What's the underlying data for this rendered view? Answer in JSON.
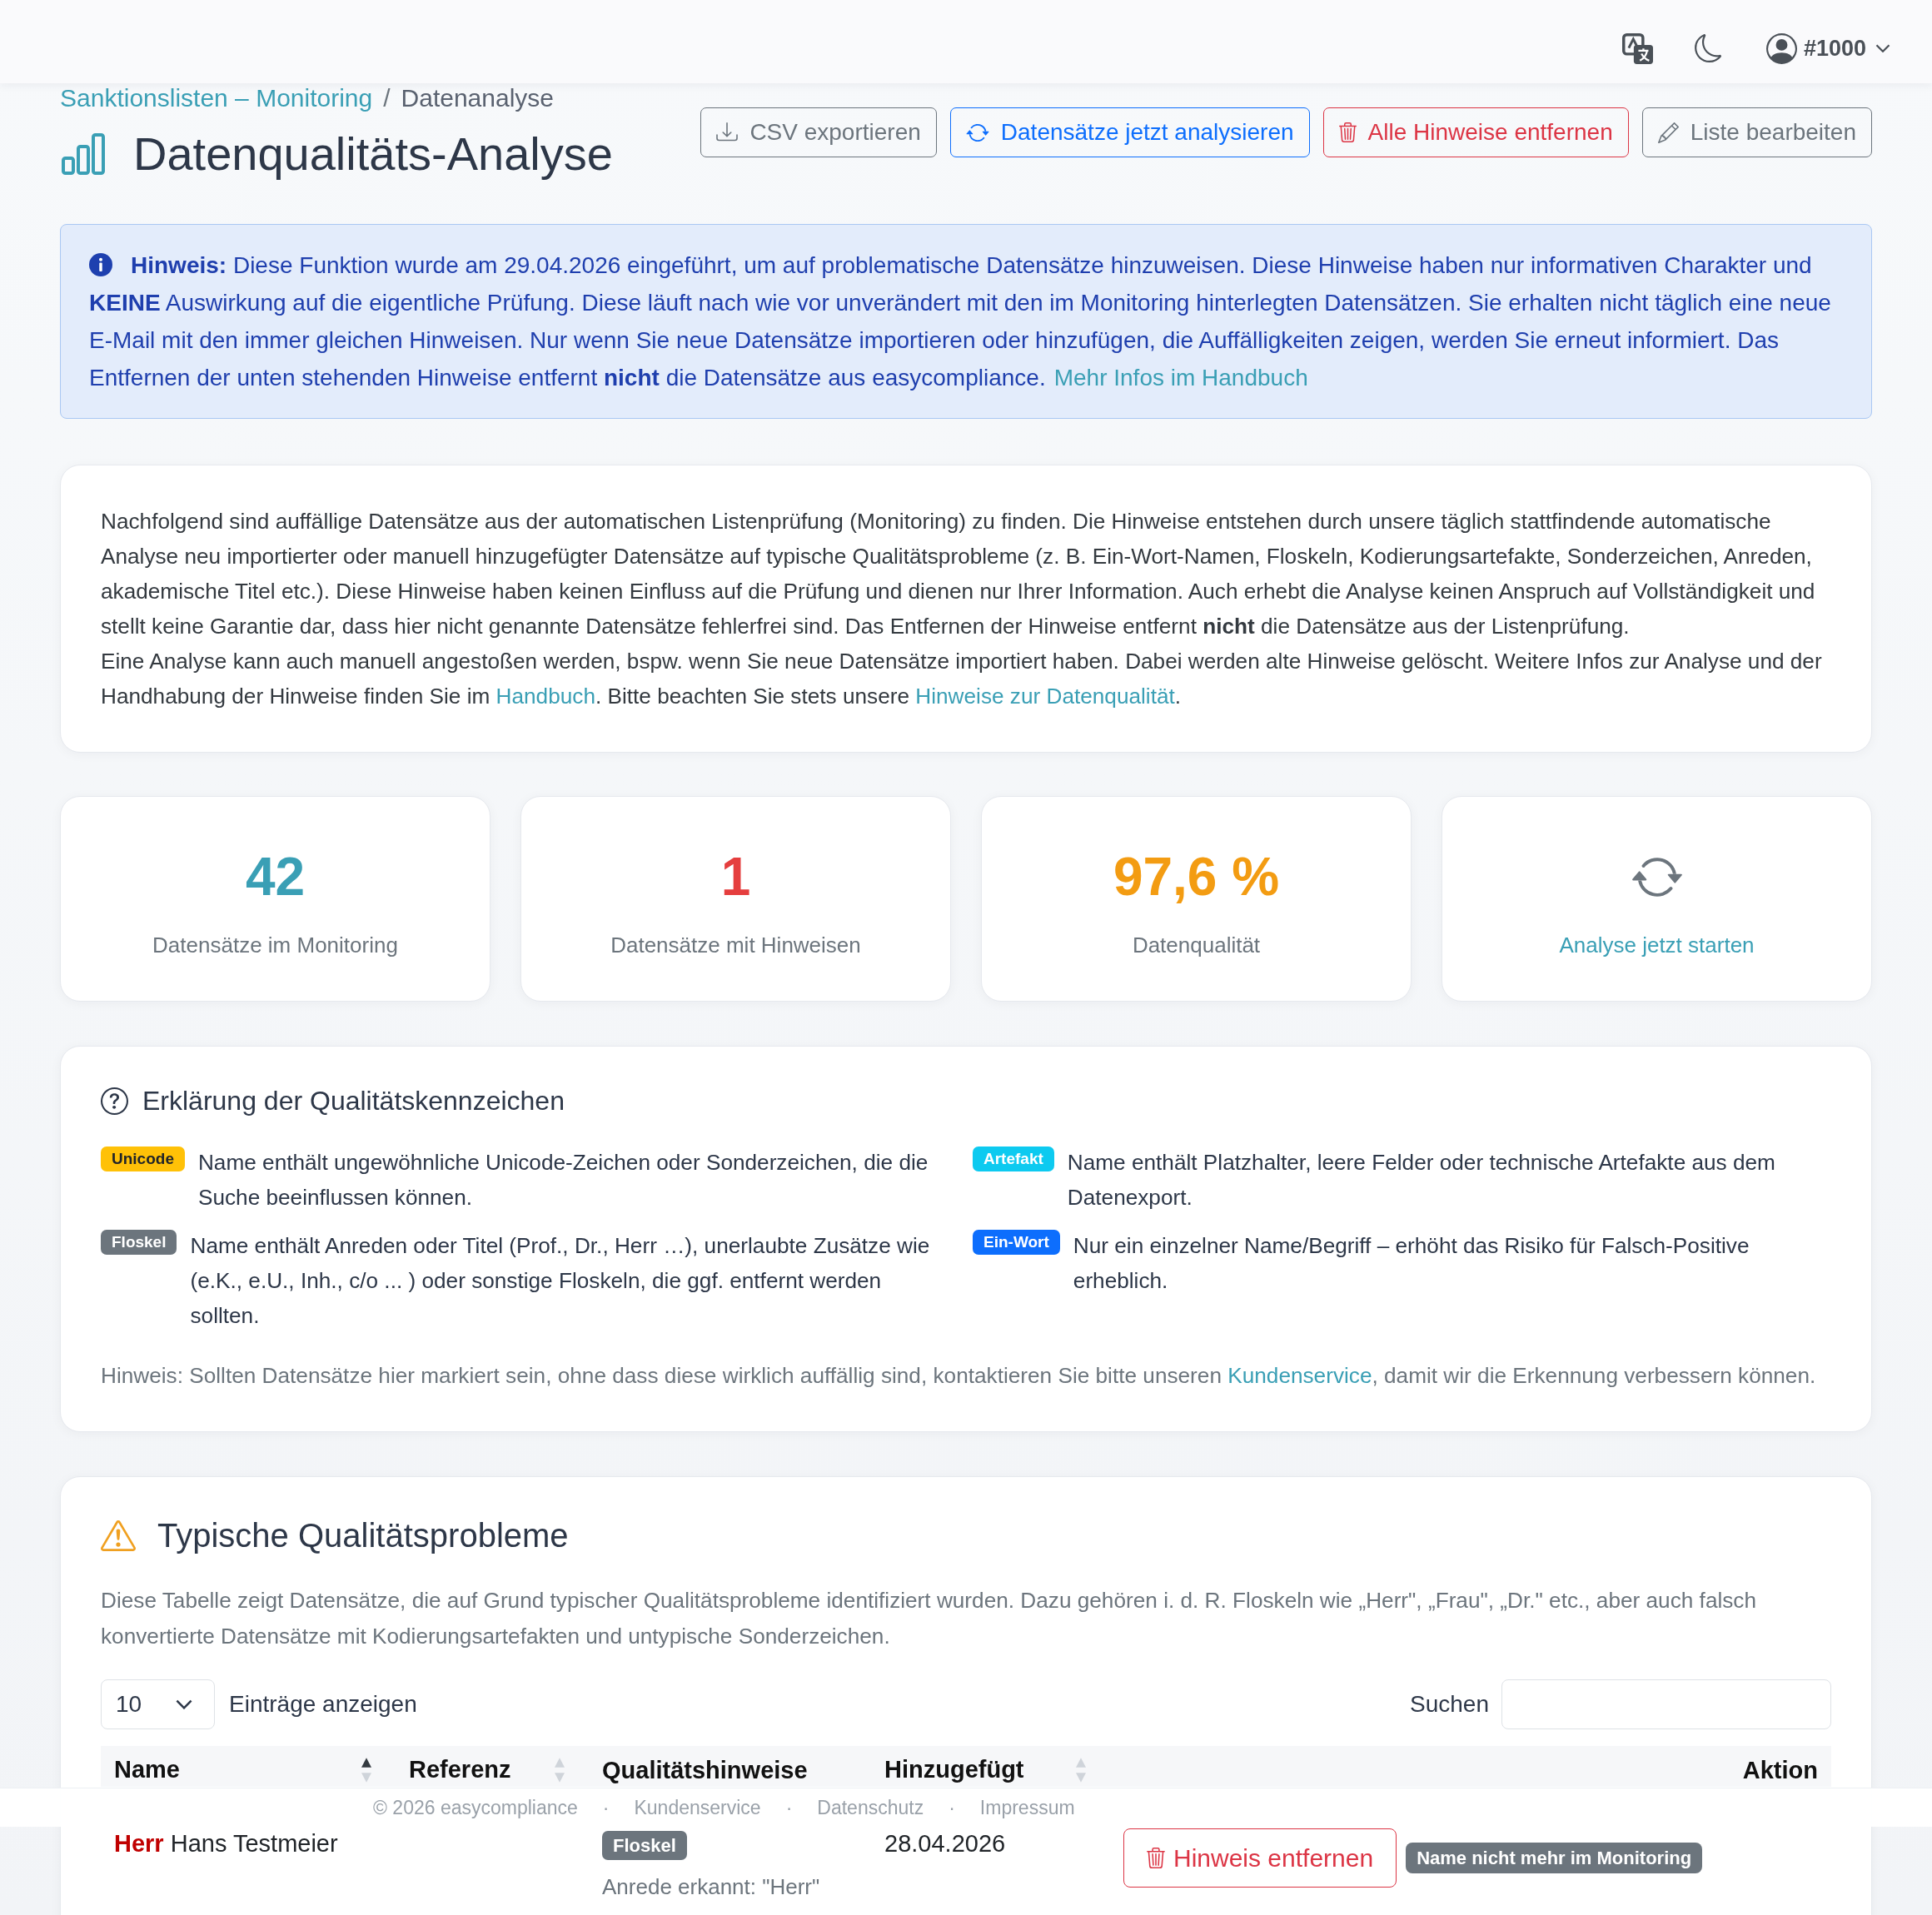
{
  "header": {
    "user_label": "#1000"
  },
  "breadcrumb": [
    {
      "kind": "link",
      "label": "Sanktionslisten – Monitoring"
    },
    {
      "kind": "separator",
      "label": "/"
    },
    {
      "kind": "current",
      "label": "Datenanalyse"
    }
  ],
  "page_title": "Datenqualitäts-Analyse",
  "actions": [
    {
      "kind": "export",
      "label": "CSV exportieren",
      "color": "#6c757d"
    },
    {
      "kind": "analyze",
      "label": "Datensätze jetzt analysieren",
      "color": "#0d6efd"
    },
    {
      "kind": "delete",
      "label": "Alle Hinweise entfernen",
      "color": "#dc3545"
    },
    {
      "kind": "edit",
      "label": "Liste bearbeiten",
      "color": "#6c757d"
    }
  ],
  "notice": [
    {
      "kind": "text",
      "text": "**Hinweis:** Diese Funktion wurde am 29.04.2026 eingeführt, um auf problematische Datensätze hinzuweisen. Diese Hinweise haben nur informativen Charakter und **KEINE** Auswirkung auf die eigentliche Prüfung. Diese läuft nach wie vor unverändert mit den im Monitoring hinterlegten Datensätzen. Sie erhalten nicht täglich eine neue E-Mail mit den immer gleichen Hinweisen. Nur wenn Sie neue Datensätze importieren oder hinzufügen, die Auffälligkeiten zeigen, werden Sie erneut informiert. Das Entfernen der unten stehenden Hinweise entfernt **nicht** die Datensätze aus easycompliance."
    },
    {
      "kind": "link",
      "text": "Mehr Infos im Handbuch"
    }
  ],
  "intro": {
    "paragraphs": [
      [
        {
          "kind": "text",
          "text": "Nachfolgend sind auffällige Datensätze aus der automatischen Listenprüfung (Monitoring) zu finden. Die Hinweise entstehen durch unsere täglich stattfindende automatische Analyse neu importierter oder manuell hinzugefügter Datensätze auf typische Qualitätsprobleme (z. B. Ein-Wort-Namen, Floskeln, Kodierungsartefakte, Sonderzeichen, Anreden, akademische Titel etc.). Diese Hinweise haben keinen Einfluss auf die Prüfung und dienen nur Ihrer Information. Auch erhebt die Analyse keinen Anspruch auf Vollständigkeit und stellt keine Garantie dar, dass hier nicht genannte Datensätze fehlerfrei sind. Das Entfernen der Hinweise entfernt **nicht** die Datensätze aus der Listenprüfung."
        }
      ],
      [
        {
          "kind": "text",
          "text": "Eine Analyse kann auch manuell angestoßen werden, bspw. wenn Sie neue Datensätze importiert haben. Dabei werden alte Hinweise gelöscht. Weitere Infos zur Analyse und der Handhabung der Hinweise finden Sie im "
        },
        {
          "kind": "link",
          "text": "Handbuch"
        },
        {
          "kind": "text",
          "text": ". Bitte beachten Sie stets unsere "
        },
        {
          "kind": "link",
          "text": "Hinweise zur Datenqualität"
        },
        {
          "kind": "text",
          "text": "."
        }
      ]
    ]
  },
  "stats": [
    {
      "kind": "metric",
      "value": "42",
      "label": "Datensätze im Monitoring",
      "color": "#3a9fb5"
    },
    {
      "kind": "metric",
      "value": "1",
      "label": "Datensätze mit Hinweisen",
      "color": "#e53e3e"
    },
    {
      "kind": "metric",
      "value": "97,6 %",
      "label": "Datenqualität",
      "color": "#f39c12"
    },
    {
      "kind": "action",
      "label": "Analyse jetzt starten"
    }
  ],
  "legend": {
    "title": "Erklärung der Qualitätskennzeichen",
    "items": [
      {
        "tag": "Unicode",
        "color": "#ffc107",
        "text": "Name enthält ungewöhnliche Unicode-Zeichen oder Sonderzeichen, die die Suche beeinflussen können."
      },
      {
        "tag": "Artefakt",
        "color": "#0dcaf0",
        "text": "Name enthält Platzhalter, leere Felder oder technische Artefakte aus dem Datenexport."
      },
      {
        "tag": "Floskel",
        "color": "#6c757d",
        "text": "Name enthält Anreden oder Titel (Prof., Dr., Herr …), unerlaubte Zusätze wie (e.K., e.U., Inh., c/o ... ) oder sonstige Floskeln, die ggf. entfernt werden sollten."
      },
      {
        "tag": "Ein-Wort",
        "color": "#0d6efd",
        "text": "Nur ein einzelner Name/Begriff – erhöht das Risiko für Falsch-Positive erheblich."
      }
    ],
    "hint": [
      {
        "kind": "text",
        "text": "Hinweis: Sollten Datensätze hier markiert sein, ohne dass diese wirklich auffällig sind, kontaktieren Sie bitte unseren "
      },
      {
        "kind": "link",
        "text": "Kundenservice"
      },
      {
        "kind": "text",
        "text": ", damit wir die Erkennung verbessern können."
      }
    ]
  },
  "problems": {
    "title": "Typische Qualitätsprobleme",
    "description": "Diese Tabelle zeigt Datensätze, die auf Grund typischer Qualitätsprobleme identifiziert wurden. Dazu gehören i. d. R. Floskeln wie „Herr\", „Frau\", „Dr.\" etc., aber auch falsch konvertierte Datensätze mit Kodierungsartefakten und untypische Sonderzeichen.",
    "page_size": "10",
    "length_label": "Einträge anzeigen",
    "search_label": "Suchen",
    "table": {
      "columns": [
        {
          "label": "Name",
          "sortable": true,
          "sorted": true
        },
        {
          "label": "Referenz",
          "sortable": true,
          "sorted": false
        },
        {
          "label": "Qualitätshinweise",
          "sortable": false
        },
        {
          "label": "Hinzugefügt",
          "sortable": true,
          "sorted": false
        },
        {
          "label": "Aktion",
          "sortable": false
        }
      ],
      "rows": [
        {
          "name": "**Herr** Hans Testmeier",
          "hints": [
            {
              "tag": "Floskel",
              "color": "#6c757d",
              "detail": "Anrede erkannt: \"Herr\""
            }
          ],
          "added": "28.04.2026",
          "action": "Hinweis entfernen",
          "status": "Name nicht mehr im Monitoring"
        }
      ]
    }
  },
  "footer": {
    "copyright": "© 2026 easycompliance",
    "links": [
      {
        "separator": "·",
        "label": "Kundenservice"
      },
      {
        "separator": "·",
        "label": "Datenschutz"
      },
      {
        "separator": "·",
        "label": "Impressum"
      }
    ]
  }
}
